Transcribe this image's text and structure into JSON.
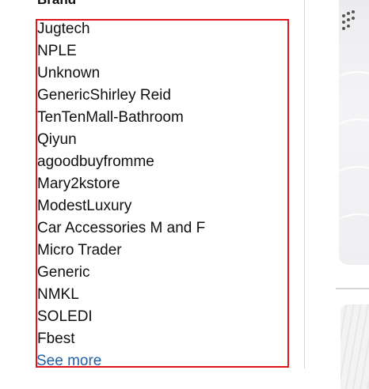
{
  "filter": {
    "heading": "Brand",
    "brands": [
      "Jugtech",
      "NPLE",
      "Unknown",
      "GenericShirley Reid",
      "TenTenMall-Bathroom",
      "Qiyun",
      "agoodbuyfromme",
      "Mary2kstore",
      "ModestLuxury",
      "Car Accessories M and F",
      "Micro Trader",
      "Generic",
      "NMKL",
      "SOLEDI",
      "Fbest"
    ],
    "see_more_label": "See more"
  },
  "colors": {
    "highlight_border": "#e0151c",
    "link": "#2162a1",
    "text": "#0f1111",
    "divider": "#d5d9d9"
  }
}
